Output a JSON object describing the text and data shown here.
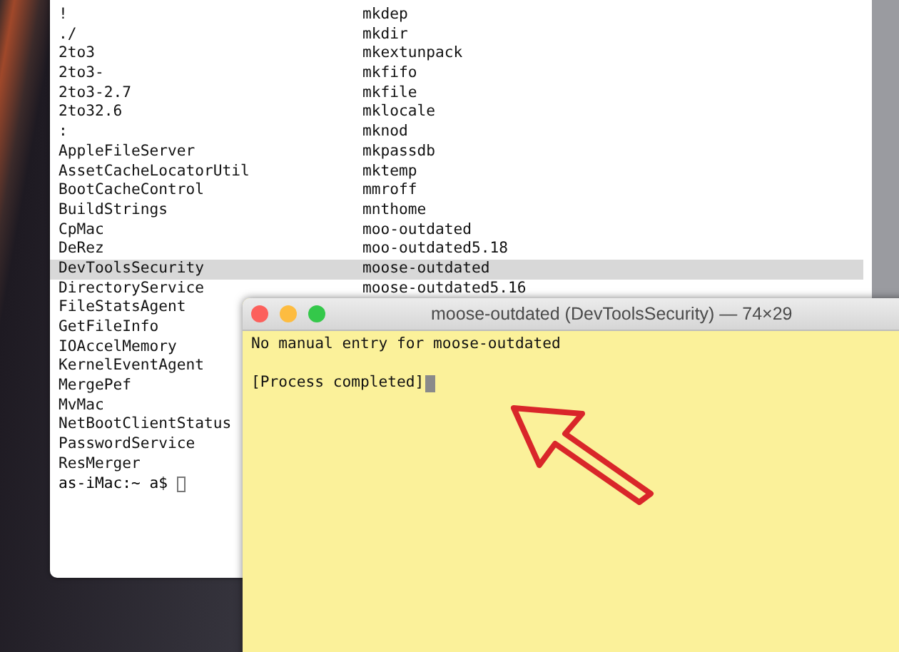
{
  "back_terminal": {
    "rows": [
      {
        "left": "!",
        "right": "mkdep",
        "selected": false
      },
      {
        "left": "./",
        "right": "mkdir",
        "selected": false
      },
      {
        "left": "2to3",
        "right": "mkextunpack",
        "selected": false
      },
      {
        "left": "2to3-",
        "right": "mkfifo",
        "selected": false
      },
      {
        "left": "2to3-2.7",
        "right": "mkfile",
        "selected": false
      },
      {
        "left": "2to32.6",
        "right": "mklocale",
        "selected": false
      },
      {
        "left": ":",
        "right": "mknod",
        "selected": false
      },
      {
        "left": "AppleFileServer",
        "right": "mkpassdb",
        "selected": false
      },
      {
        "left": "AssetCacheLocatorUtil",
        "right": "mktemp",
        "selected": false
      },
      {
        "left": "BootCacheControl",
        "right": "mmroff",
        "selected": false
      },
      {
        "left": "BuildStrings",
        "right": "mnthome",
        "selected": false
      },
      {
        "left": "CpMac",
        "right": "moo-outdated",
        "selected": false
      },
      {
        "left": "DeRez",
        "right": "moo-outdated5.18",
        "selected": false
      },
      {
        "left": "DevToolsSecurity",
        "right": "moose-outdated",
        "selected": true
      },
      {
        "left": "DirectoryService",
        "right": "moose-outdated5.16",
        "selected": false
      },
      {
        "left": "FileStatsAgent",
        "selected": false
      },
      {
        "left": "GetFileInfo",
        "selected": false
      },
      {
        "left": "IOAccelMemory",
        "selected": false
      },
      {
        "left": "KernelEventAgent",
        "selected": false
      },
      {
        "left": "MergePef",
        "selected": false
      },
      {
        "left": "MvMac",
        "selected": false
      },
      {
        "left": "NetBootClientStatus",
        "selected": false
      },
      {
        "left": "PasswordService",
        "selected": false
      },
      {
        "left": "ResMerger",
        "selected": false
      }
    ],
    "prompt": "as-iMac:~ a$"
  },
  "front_terminal": {
    "title": "moose-outdated (DevToolsSecurity) — 74×29",
    "lines": [
      "No manual entry for moose-outdated",
      "[Process completed]"
    ]
  }
}
